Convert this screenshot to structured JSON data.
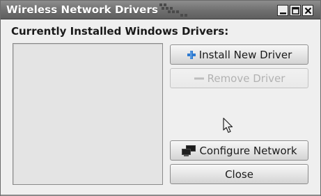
{
  "window": {
    "title": "Wireless Network Drivers",
    "controls": {
      "minimize_icon": "minimize-icon",
      "maximize_icon": "maximize-icon",
      "close_icon": "close-icon"
    }
  },
  "main": {
    "section_label": "Currently Installed Windows Drivers:",
    "driver_list_items": []
  },
  "buttons": {
    "install": {
      "label": "Install New Driver",
      "icon": "plus-icon",
      "enabled": true
    },
    "remove": {
      "label": "Remove Driver",
      "icon": "minus-icon",
      "enabled": false
    },
    "configure": {
      "label": "Configure Network",
      "icon": "network-icon",
      "enabled": true
    },
    "close": {
      "label": "Close",
      "enabled": true
    }
  },
  "colors": {
    "titlebar": "#6f6f6f",
    "window_bg": "#efefef",
    "install_icon": "#2f7bd0"
  }
}
